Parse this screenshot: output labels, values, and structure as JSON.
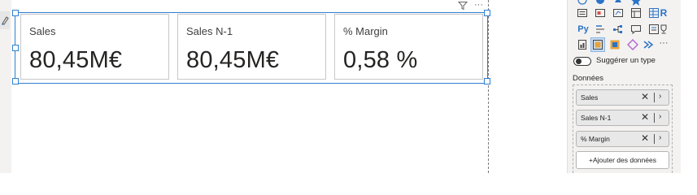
{
  "cards": [
    {
      "label": "Sales",
      "value": "80,45M€"
    },
    {
      "label": "Sales N-1",
      "value": "80,45M€"
    },
    {
      "label": "% Margin",
      "value": "0,58 %"
    }
  ],
  "visual_header": {
    "more_options": "···"
  },
  "visualizations": {
    "r_visual_label": "R",
    "python_visual_label": "Py",
    "more_visuals": "···"
  },
  "suggest_type": {
    "label": "Suggérer un type",
    "enabled": false
  },
  "data_section": {
    "title": "Données",
    "fields": [
      {
        "name": "Sales"
      },
      {
        "name": "Sales N-1"
      },
      {
        "name": "% Margin"
      }
    ],
    "remove_glyph": "✕",
    "expand_glyph": "›",
    "add_button": "+Ajouter des données"
  },
  "colors": {
    "selection": "#2f7fd1",
    "accent_yellow": "#e8a33d",
    "accent_blue": "#2b73c6"
  }
}
